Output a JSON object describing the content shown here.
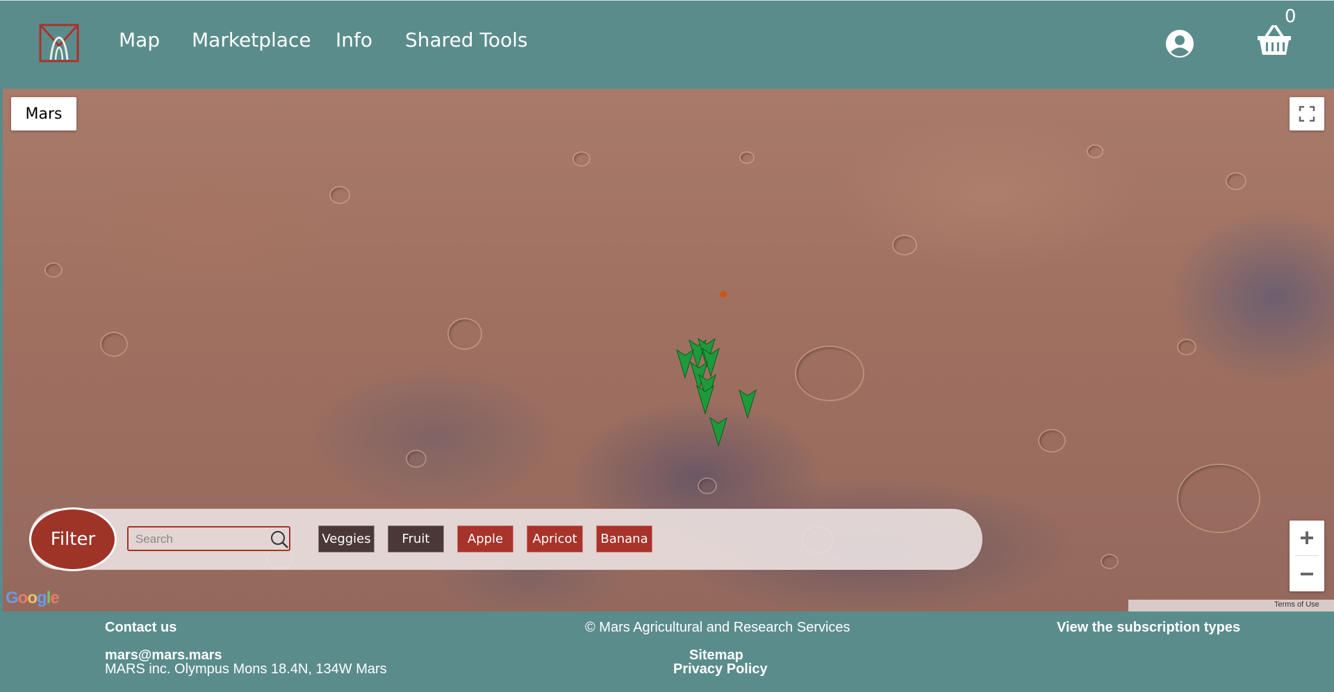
{
  "header": {
    "nav": [
      "Map",
      "Marketplace",
      "Info",
      "Shared Tools"
    ],
    "cart_count": "0"
  },
  "map": {
    "type_label": "Mars",
    "zoom_in": "+",
    "zoom_out": "−",
    "terms": "Terms of Use",
    "attribution": "Google"
  },
  "filter": {
    "button_label": "Filter",
    "search_placeholder": "Search",
    "chips": [
      {
        "label": "Veggies",
        "style": "dark"
      },
      {
        "label": "Fruit",
        "style": "dark"
      },
      {
        "label": "Apple",
        "style": "red"
      },
      {
        "label": "Apricot",
        "style": "red"
      },
      {
        "label": "Banana",
        "style": "red"
      }
    ]
  },
  "footer": {
    "contact_label": "Contact us",
    "email": "mars@mars.mars",
    "address": "MARS inc. Olympus Mons 18.4N, 134W Mars",
    "copyright": "© Mars Agricultural and Research Services",
    "sitemap": "Sitemap",
    "privacy": "Privacy Policy",
    "subscription": "View the subscription types"
  },
  "colors": {
    "header_bg": "#5b8c8c",
    "accent_red": "#9e3328",
    "chip_dark": "#4a3836",
    "marker_green": "#1f9a3a"
  }
}
